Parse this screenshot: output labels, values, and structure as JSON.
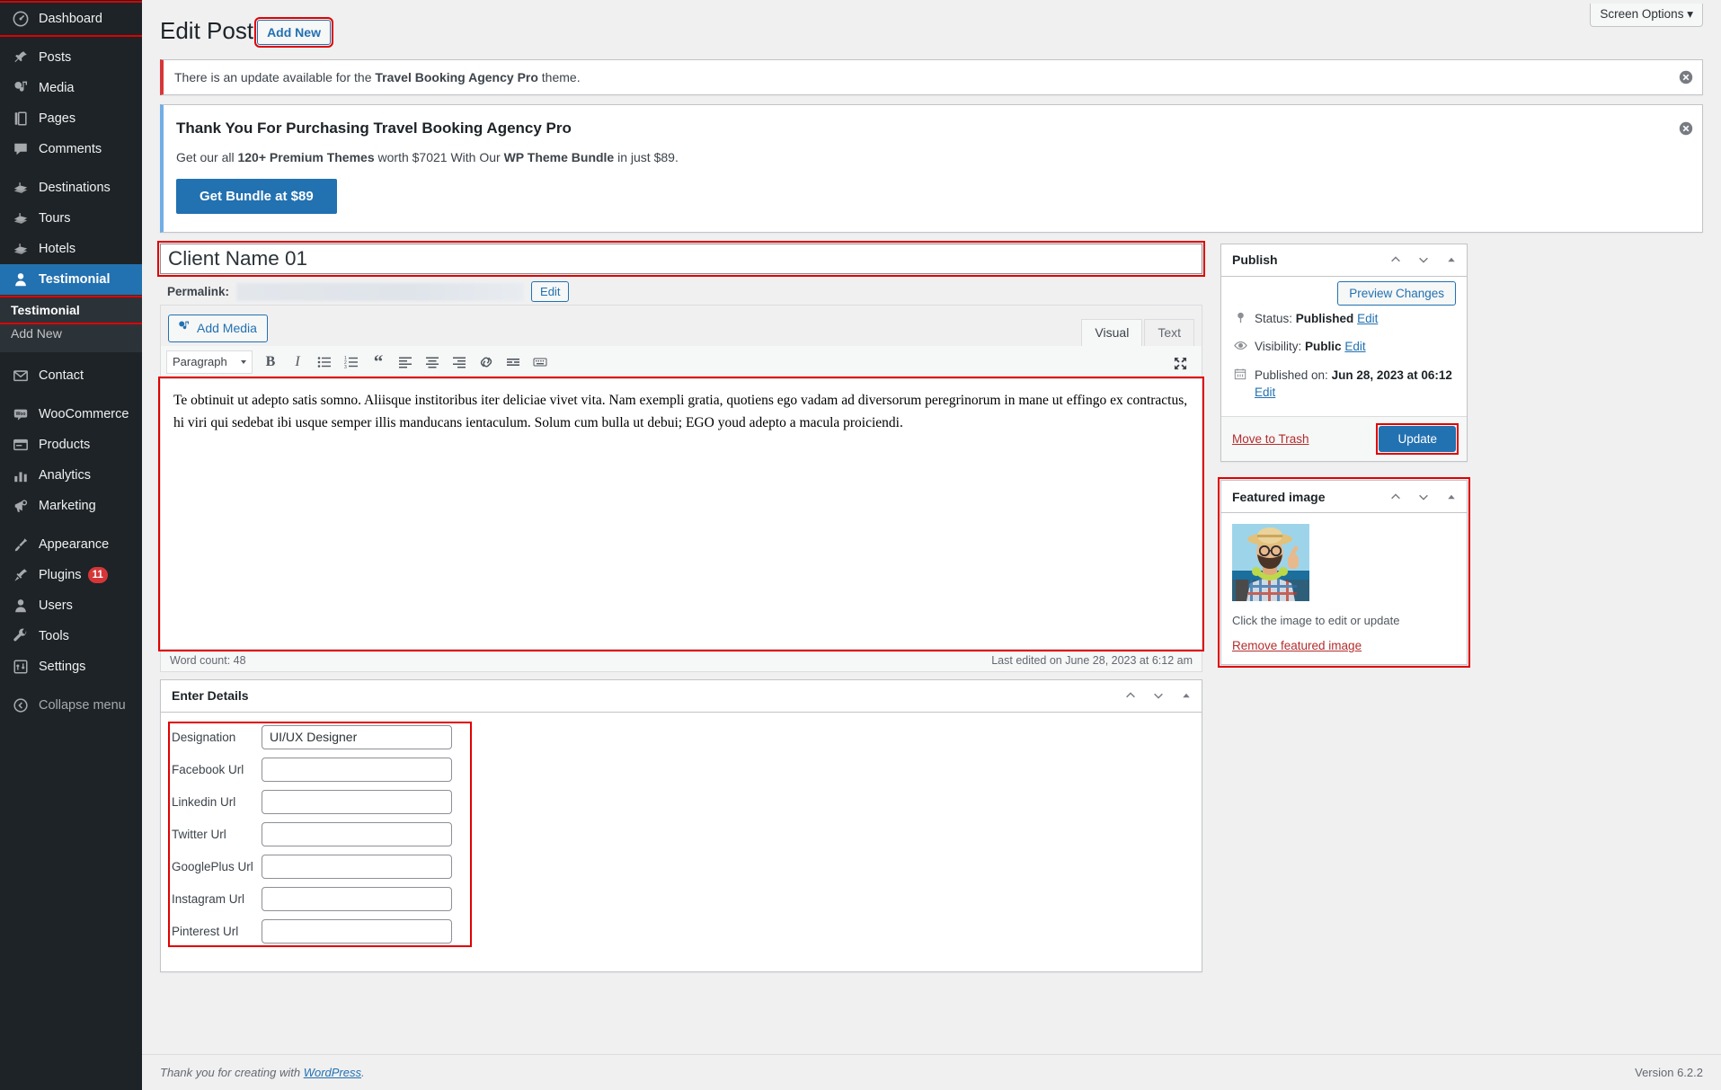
{
  "sidebar": {
    "items": [
      {
        "label": "Dashboard",
        "icon": "dashboard-icon",
        "highlighted": true
      },
      {
        "label": "Posts",
        "icon": "pin-icon"
      },
      {
        "label": "Media",
        "icon": "media-icon"
      },
      {
        "label": "Pages",
        "icon": "pages-icon"
      },
      {
        "label": "Comments",
        "icon": "comments-icon"
      },
      {
        "label": "Destinations",
        "icon": "megaphone-icon"
      },
      {
        "label": "Tours",
        "icon": "megaphone-icon"
      },
      {
        "label": "Hotels",
        "icon": "megaphone-icon"
      },
      {
        "label": "Testimonial",
        "icon": "user-icon",
        "current": true
      },
      {
        "label": "Contact",
        "icon": "envelope-icon"
      },
      {
        "label": "WooCommerce",
        "icon": "woo-icon"
      },
      {
        "label": "Products",
        "icon": "products-icon"
      },
      {
        "label": "Analytics",
        "icon": "bar-chart-icon"
      },
      {
        "label": "Marketing",
        "icon": "marketing-icon"
      },
      {
        "label": "Appearance",
        "icon": "brush-icon"
      },
      {
        "label": "Plugins",
        "icon": "plug-icon",
        "badge": "11"
      },
      {
        "label": "Users",
        "icon": "users-icon"
      },
      {
        "label": "Tools",
        "icon": "wrench-icon"
      },
      {
        "label": "Settings",
        "icon": "settings-icon"
      },
      {
        "label": "Collapse menu",
        "icon": "collapse-icon"
      }
    ],
    "submenu": {
      "items": [
        {
          "label": "Testimonial",
          "current": true
        },
        {
          "label": "Add New",
          "current": false
        }
      ]
    }
  },
  "screen_meta": {
    "screen_options_label": "Screen Options",
    "caret": "▾"
  },
  "header": {
    "title": "Edit Post",
    "add_new_label": "Add New"
  },
  "notices": {
    "update": {
      "text_before": "There is an update available for the ",
      "theme_name": "Travel Booking Agency Pro",
      "text_after": " theme."
    },
    "promo": {
      "heading": "Thank You For Purchasing Travel Booking Agency Pro",
      "line_part1": "Get our all ",
      "bold1": "120+ Premium Themes",
      "line_part2": " worth $7021 With Our ",
      "bold2": "WP Theme Bundle",
      "line_part3": " in just $89.",
      "button_label": "Get Bundle at $89"
    }
  },
  "post": {
    "title_value": "Client Name 01",
    "title_placeholder": "Add title",
    "permalink_label": "Permalink:",
    "permalink_edit_label": "Edit"
  },
  "editor": {
    "add_media_label": "Add Media",
    "tabs": [
      {
        "label": "Visual",
        "active": true
      },
      {
        "label": "Text",
        "active": false
      }
    ],
    "format_select": "Paragraph",
    "toolbar_buttons": [
      "bold-icon",
      "italic-icon",
      "bulleted-list-icon",
      "numbered-list-icon",
      "blockquote-icon",
      "align-left-icon",
      "align-center-icon",
      "align-right-icon",
      "link-icon",
      "read-more-icon",
      "keyboard-toolbar-icon"
    ],
    "fullscreen_icon": "fullscreen-icon",
    "content": "Te obtinuit ut adepto satis somno. Aliisque institoribus iter deliciae vivet vita. Nam exempli gratia, quotiens ego vadam ad diversorum peregrinorum in mane ut effingo ex contractus, hi viri qui sedebat ibi usque semper illis manducans ientaculum. Solum cum bulla ut debui; EGO youd adepto a macula proiciendi.",
    "word_count": "Word count: 48",
    "last_edited": "Last edited on June 28, 2023 at 6:12 am"
  },
  "publish_box": {
    "title": "Publish",
    "preview_label": "Preview Changes",
    "status_label": "Status:",
    "status_value": "Published",
    "status_edit": "Edit",
    "visibility_label": "Visibility:",
    "visibility_value": "Public",
    "visibility_edit": "Edit",
    "published_label": "Published on:",
    "published_value": "Jun 28, 2023 at 06:12",
    "published_edit": "Edit",
    "trash_label": "Move to Trash",
    "update_label": "Update"
  },
  "featured_image_box": {
    "title": "Featured image",
    "hint": "Click the image to edit or update",
    "remove_label": "Remove featured image"
  },
  "enter_details": {
    "title": "Enter Details",
    "fields": [
      {
        "label": "Designation",
        "value": "UI/UX Designer",
        "placeholder": ""
      },
      {
        "label": "Facebook Url",
        "value": "",
        "placeholder": ""
      },
      {
        "label": "Linkedin Url",
        "value": "",
        "placeholder": ""
      },
      {
        "label": "Twitter Url",
        "value": "",
        "placeholder": ""
      },
      {
        "label": "GooglePlus Url",
        "value": "",
        "placeholder": ""
      },
      {
        "label": "Instagram Url",
        "value": "",
        "placeholder": ""
      },
      {
        "label": "Pinterest Url",
        "value": "",
        "placeholder": ""
      }
    ]
  },
  "footer": {
    "thanks_prefix": "Thank you for creating with ",
    "wordpress_link": "WordPress",
    "thanks_suffix": ".",
    "version": "Version 6.2.2"
  },
  "colors": {
    "accent": "#2271b1",
    "sidebar_bg": "#1d2327",
    "submenu_bg": "#2c3338",
    "danger": "#d63638",
    "highlight_outline": "#e00000"
  }
}
